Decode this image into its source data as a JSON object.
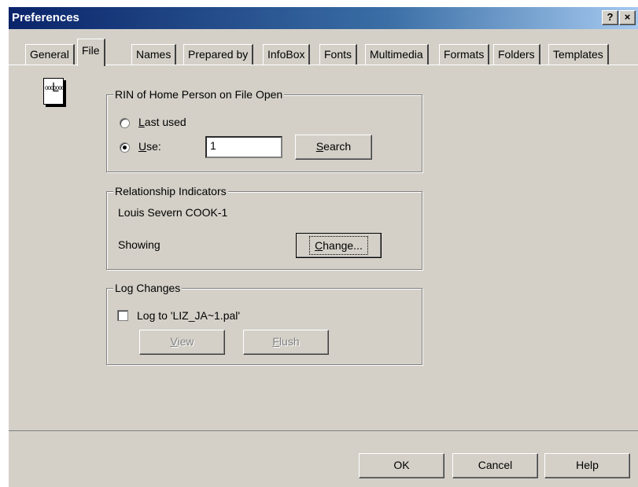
{
  "window": {
    "title": "Preferences",
    "help_button": "?",
    "close_button": "×"
  },
  "tabs": [
    {
      "label": "General"
    },
    {
      "label": "File"
    },
    {
      "label": "Names"
    },
    {
      "label": "Prepared by"
    },
    {
      "label": "InfoBox"
    },
    {
      "label": "Fonts"
    },
    {
      "label": "Multimedia"
    },
    {
      "label": "Formats"
    },
    {
      "label": "Folders"
    },
    {
      "label": "Templates"
    }
  ],
  "active_tab": "File",
  "rin_group": {
    "title": "RIN of Home Person on File Open",
    "last_used_label_u": "L",
    "last_used_label_rest": "ast used",
    "use_label_u": "U",
    "use_label_rest": "se:",
    "use_value": "1",
    "search_button_u": "S",
    "search_button_rest": "earch"
  },
  "relationship_group": {
    "title": "Relationship Indicators",
    "person": "Louis Severn COOK-1",
    "status": "Showing",
    "change_button_u": "C",
    "change_button_rest": "hange..."
  },
  "log_group": {
    "title": "Log Changes",
    "log_label": "Log to 'LIZ_JA~1.pal'",
    "view_button_u": "V",
    "view_button_rest": "iew",
    "flush_button_u": "F",
    "flush_button_rest": "lush"
  },
  "footer": {
    "ok": "OK",
    "cancel": "Cancel",
    "help": "Help"
  }
}
